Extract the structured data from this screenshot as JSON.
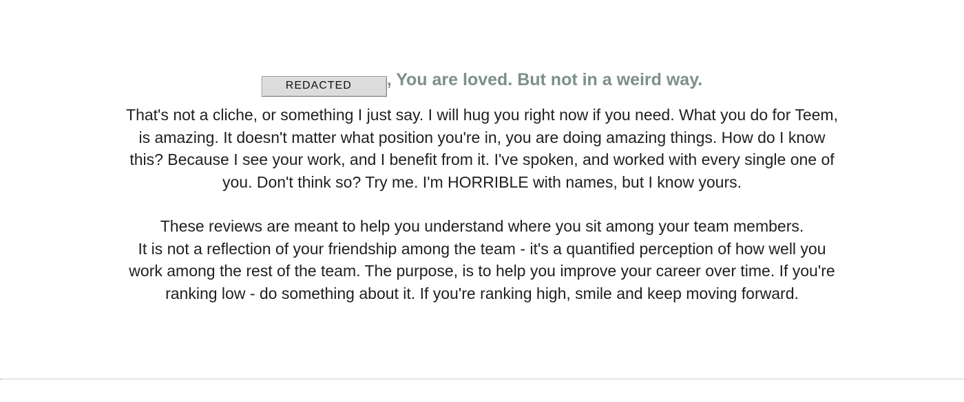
{
  "heading": {
    "redacted_label": "REDACTED",
    "text": ", You are loved. But not in a weird way."
  },
  "paragraph_1": {
    "lines": [
      "That's not a cliche, or something I just say. I will hug you right now if you need. What you do for Teem,",
      "is amazing. It doesn't matter what position you're in, you are doing amazing things. How do I know",
      "this? Because I see your work, and I benefit from it. I've spoken, and worked with every single one of",
      "you. Don't think so? Try me. I'm HORRIBLE with names, but I know yours."
    ]
  },
  "paragraph_2": {
    "lines": [
      "These reviews are meant to help you understand where you sit among your team members.",
      "It is not a reflection of your friendship among the team - it's a quantified perception of how well you",
      "work among the rest of the team. The purpose, is to help you improve your career over time. If you're",
      "ranking low - do something about it. If you're ranking high, smile and keep moving forward."
    ]
  },
  "colors": {
    "heading": "#7d8f8c",
    "body_text": "#1f1f1f",
    "redacted_fill": "#dcdcdc"
  }
}
